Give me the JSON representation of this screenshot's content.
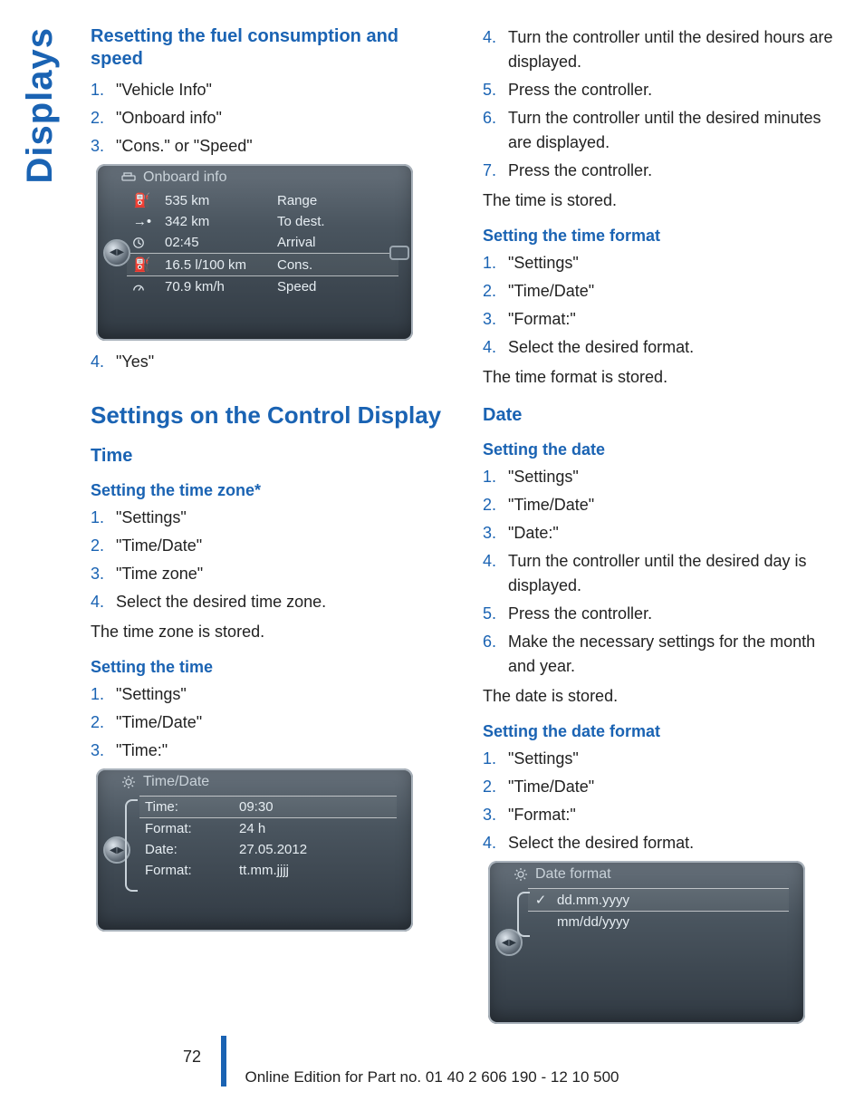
{
  "sideTab": "Displays",
  "pageNumber": "72",
  "footer": "Online Edition for Part no. 01 40 2 606 190 - 12 10 500",
  "left": {
    "h_reset": "Resetting the fuel consumption and speed",
    "reset_steps": [
      "\"Vehicle Info\"",
      "\"Onboard info\"",
      "\"Cons.\" or \"Speed\""
    ],
    "reset_step4": "\"Yes\"",
    "onboard": {
      "title": "Onboard info",
      "rows": [
        {
          "icon": "fuel-pump-range-icon",
          "value": "535 km",
          "label": "Range"
        },
        {
          "icon": "arrow-dot-icon",
          "value": "342 km",
          "label": "To dest."
        },
        {
          "icon": "clock-icon",
          "value": "02:45",
          "label": "Arrival"
        },
        {
          "icon": "fuel-pump-icon",
          "value": "16.5 l/100 km",
          "label": "Cons.",
          "selected": true
        },
        {
          "icon": "speedometer-icon",
          "value": "70.9 km/h",
          "label": "Speed"
        }
      ]
    },
    "h_settings_section": "Settings on the Control Display",
    "h_time": "Time",
    "h_tz": "Setting the time zone*",
    "tz_steps": [
      "\"Settings\"",
      "\"Time/Date\"",
      "\"Time zone\"",
      "Select the desired time zone."
    ],
    "tz_stored": "The time zone is stored.",
    "h_set_time": "Setting the time",
    "set_time_steps": [
      "\"Settings\"",
      "\"Time/Date\"",
      "\"Time:\""
    ],
    "timedate": {
      "title": "Time/Date",
      "rows": [
        {
          "key": "Time:",
          "value": "09:30",
          "selected": true
        },
        {
          "key": "Format:",
          "value": "24 h"
        },
        {
          "key": "Date:",
          "value": "27.05.2012"
        },
        {
          "key": "Format:",
          "value": "tt.mm.jjjj"
        }
      ]
    }
  },
  "right": {
    "time_cont_steps": [
      {
        "n": "4.",
        "t": "Turn the controller until the desired hours are displayed."
      },
      {
        "n": "5.",
        "t": "Press the controller."
      },
      {
        "n": "6.",
        "t": "Turn the controller until the desired minutes are displayed."
      },
      {
        "n": "7.",
        "t": "Press the controller."
      }
    ],
    "time_stored": "The time is stored.",
    "h_time_fmt": "Setting the time format",
    "time_fmt_steps": [
      "\"Settings\"",
      "\"Time/Date\"",
      "\"Format:\"",
      "Select the desired format."
    ],
    "time_fmt_stored": "The time format is stored.",
    "h_date": "Date",
    "h_set_date": "Setting the date",
    "set_date_steps": [
      {
        "n": "1.",
        "t": "\"Settings\""
      },
      {
        "n": "2.",
        "t": "\"Time/Date\""
      },
      {
        "n": "3.",
        "t": "\"Date:\""
      },
      {
        "n": "4.",
        "t": "Turn the controller until the desired day is displayed."
      },
      {
        "n": "5.",
        "t": "Press the controller."
      },
      {
        "n": "6.",
        "t": "Make the necessary settings for the month and year."
      }
    ],
    "date_stored": "The date is stored.",
    "h_date_fmt": "Setting the date format",
    "date_fmt_steps": [
      "\"Settings\"",
      "\"Time/Date\"",
      "\"Format:\"",
      "Select the desired format."
    ],
    "datefmt": {
      "title": "Date format",
      "rows": [
        {
          "label": "dd.mm.yyyy",
          "checked": true,
          "selected": true
        },
        {
          "label": "mm/dd/yyyy",
          "checked": false
        }
      ]
    }
  }
}
